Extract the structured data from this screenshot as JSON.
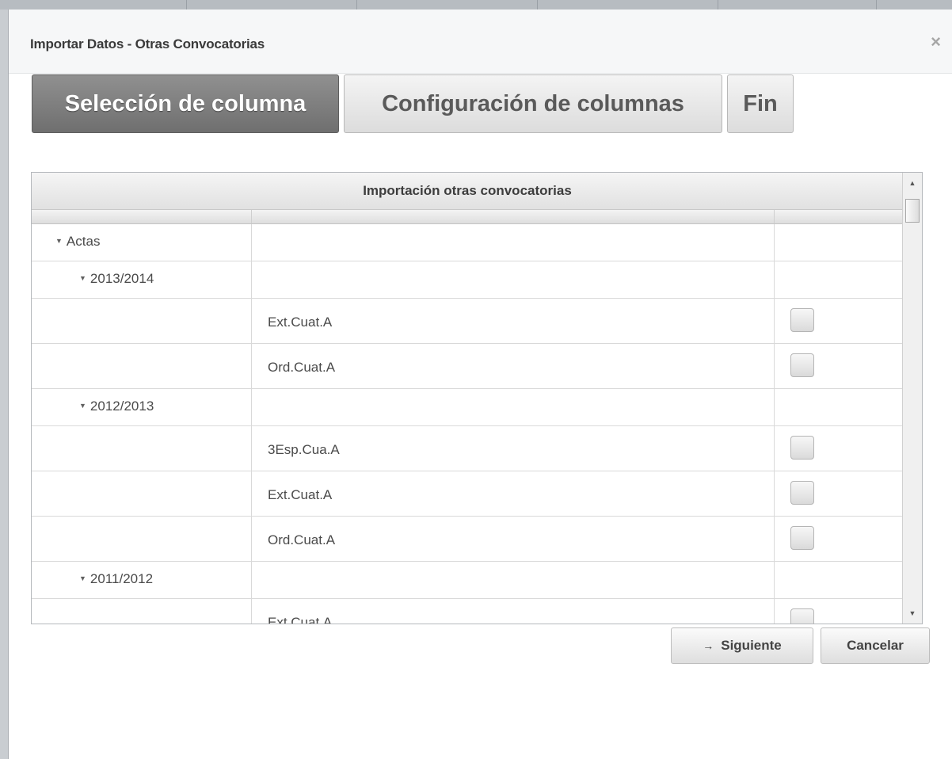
{
  "dialog": {
    "title": "Importar Datos - Otras Convocatorias",
    "close_glyph": "×"
  },
  "steps": [
    {
      "label": "Selección de columna",
      "active": true
    },
    {
      "label": "Configuración de columnas",
      "active": false
    },
    {
      "label": "Fin",
      "active": false
    }
  ],
  "grid": {
    "header": "Importación otras convocatorias",
    "rows": [
      {
        "type": "group",
        "level": 0,
        "label": "Actas"
      },
      {
        "type": "group",
        "level": 1,
        "label": "2013/2014"
      },
      {
        "type": "leaf",
        "label": "Ext.Cuat.A",
        "checked": false
      },
      {
        "type": "leaf",
        "label": "Ord.Cuat.A",
        "checked": false
      },
      {
        "type": "group",
        "level": 1,
        "label": "2012/2013"
      },
      {
        "type": "leaf",
        "label": "3Esp.Cua.A",
        "checked": false
      },
      {
        "type": "leaf",
        "label": "Ext.Cuat.A",
        "checked": false
      },
      {
        "type": "leaf",
        "label": "Ord.Cuat.A",
        "checked": false
      },
      {
        "type": "group",
        "level": 1,
        "label": "2011/2012"
      },
      {
        "type": "leaf",
        "label": "Ext.Cuat.A",
        "checked": false
      }
    ]
  },
  "buttons": {
    "next": "Siguiente",
    "next_icon": "→",
    "cancel": "Cancelar"
  },
  "icons": {
    "caret": "▼",
    "scroll_up": "▲",
    "scroll_down": "▼"
  }
}
